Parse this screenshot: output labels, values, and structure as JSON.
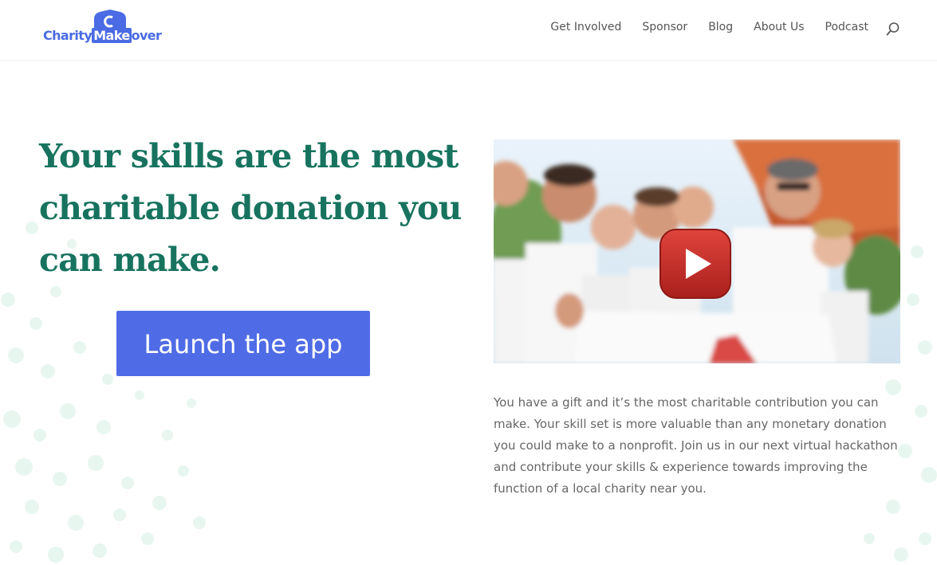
{
  "header": {
    "logo": {
      "text_charity": "Charity",
      "text_make": "Make",
      "text_over": "over"
    },
    "nav": [
      "Get Involved",
      "Sponsor",
      "Blog",
      "About Us",
      "Podcast"
    ],
    "search_icon": "search-icon"
  },
  "hero": {
    "headline": "Your skills are the most charitable donation you can make.",
    "cta_label": "Launch the app",
    "video": {
      "play_icon": "youtube-play-icon"
    },
    "description": "You have a gift and it’s the most charitable contribution you can make. Your skill set is more valuable than any monetary donation you could make to a nonprofit. Join us in our next virtual hackathon and contribute your skills & experience towards improving the function of a local charity near you."
  },
  "colors": {
    "brand_blue": "#4f6ce6",
    "headline_green": "#17735e",
    "play_red": "#c8312b",
    "dots_green": "#d6efe4"
  }
}
